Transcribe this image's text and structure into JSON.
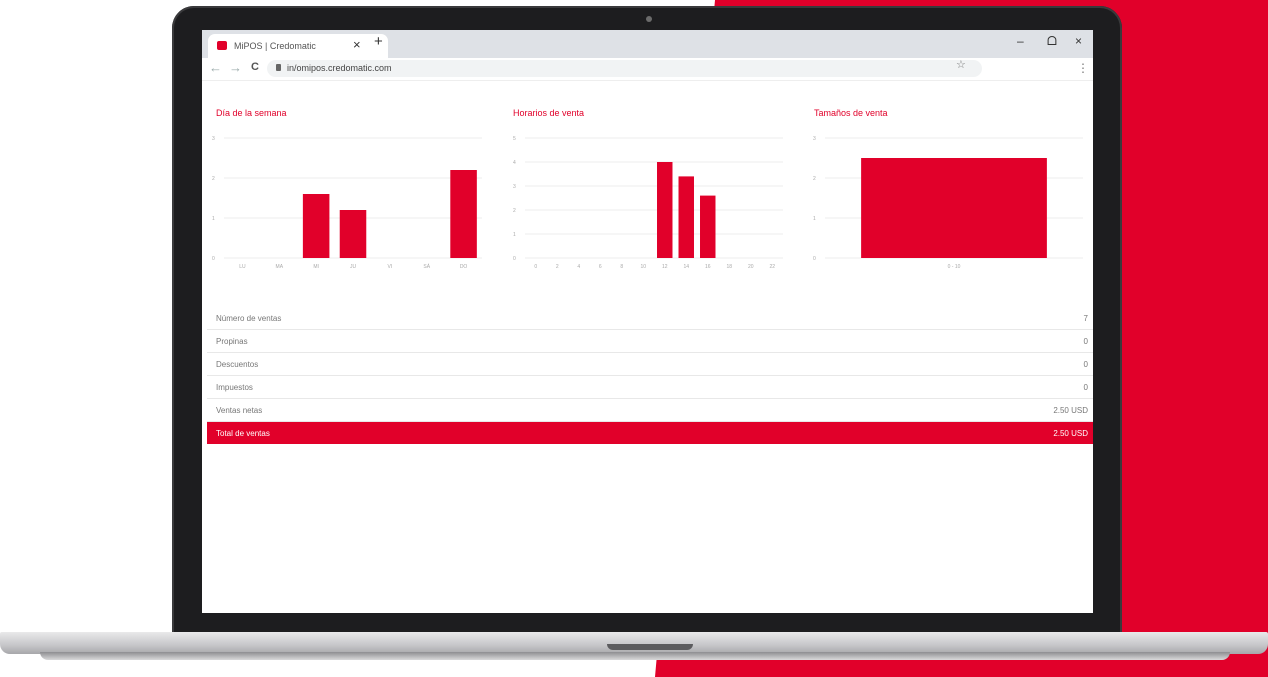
{
  "browser": {
    "tab_title": "MiPOS | Credomatic",
    "tab_close": "×",
    "new_tab": "+",
    "url": "in/omipos.credomatic.com",
    "minimize": "–",
    "restore": "ᗝ",
    "close": "×",
    "back": "←",
    "forward": "→",
    "reload": "C",
    "star": "☆",
    "menu": "⋮"
  },
  "colors": {
    "accent": "#e1002a",
    "grid": "#eeeeee",
    "text_muted": "#777777"
  },
  "chart_data": [
    {
      "type": "bar",
      "title": "Día de la semana",
      "categories": [
        "LU",
        "MA",
        "MI",
        "JU",
        "VI",
        "SÁ",
        "DO"
      ],
      "values": [
        0,
        0,
        1.6,
        1.2,
        0,
        0,
        2.2
      ],
      "ylim": [
        0,
        3
      ],
      "yticks": [
        "0",
        "1",
        "2",
        "3"
      ]
    },
    {
      "type": "bar",
      "title": "Horarios de venta",
      "categories": [
        "0",
        "2",
        "4",
        "6",
        "8",
        "10",
        "12",
        "14",
        "16",
        "18",
        "20",
        "22"
      ],
      "values": [
        0,
        0,
        0,
        0,
        0,
        0,
        4,
        3.4,
        2.6,
        0,
        0,
        0
      ],
      "ylim": [
        0,
        5
      ],
      "yticks": [
        "0",
        "1",
        "2",
        "3",
        "4",
        "5"
      ]
    },
    {
      "type": "bar",
      "title": "Tamaños de venta",
      "categories": [
        "0 - 10"
      ],
      "values": [
        2.5
      ],
      "ylim": [
        0,
        3
      ],
      "yticks": [
        "0",
        "1",
        "2",
        "3"
      ]
    }
  ],
  "summary": {
    "rows": [
      {
        "label": "Número de ventas",
        "value": "7"
      },
      {
        "label": "Propinas",
        "value": "0"
      },
      {
        "label": "Descuentos",
        "value": "0"
      },
      {
        "label": "Impuestos",
        "value": "0"
      },
      {
        "label": "Ventas netas",
        "value": "2.50 USD"
      }
    ],
    "total": {
      "label": "Total de ventas",
      "value": "2.50 USD"
    }
  }
}
